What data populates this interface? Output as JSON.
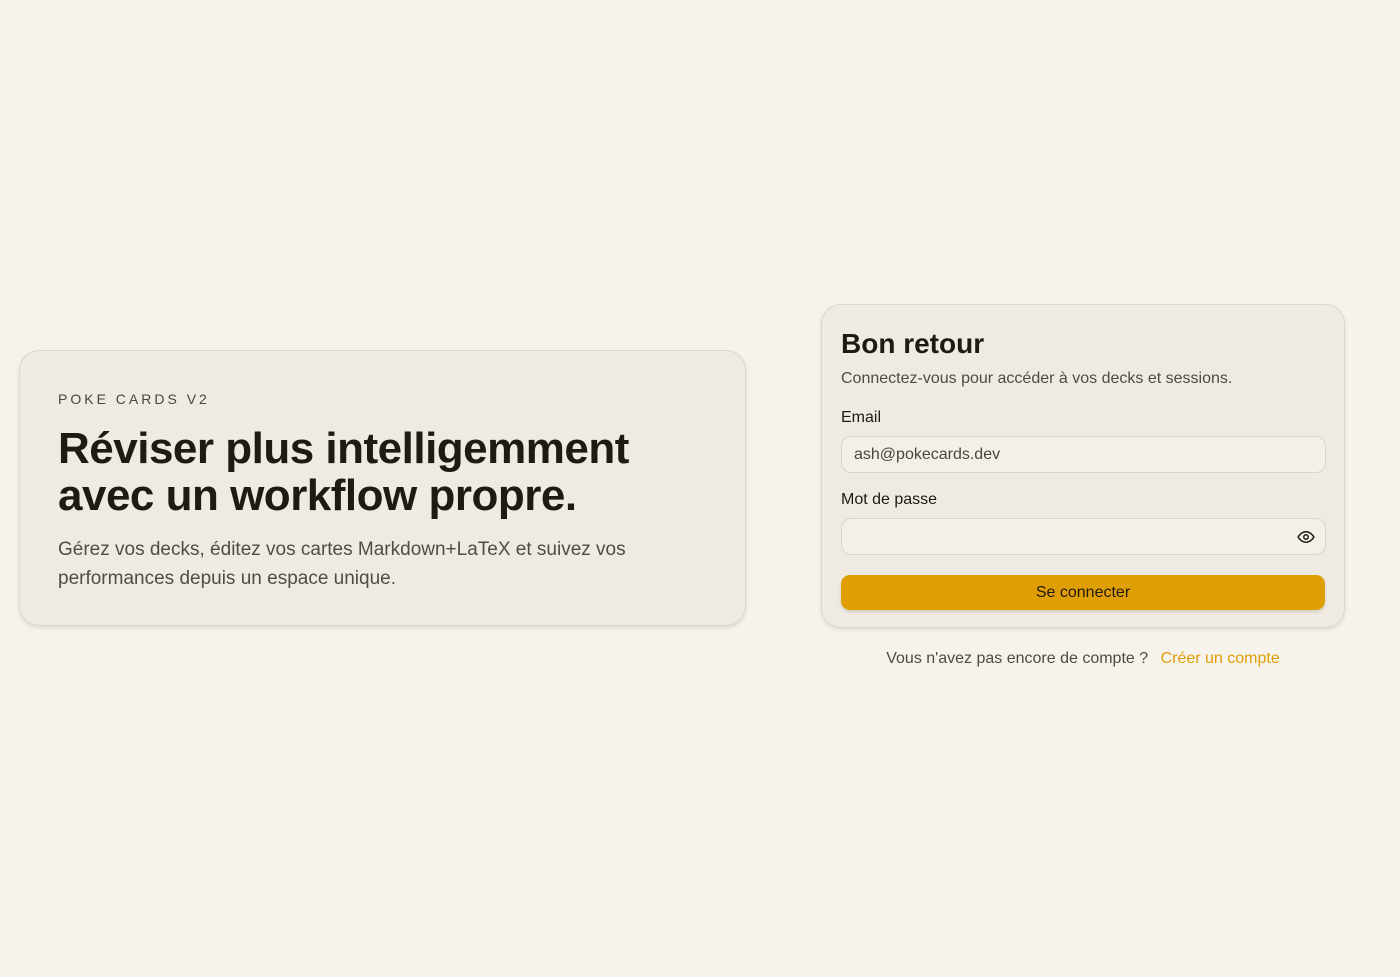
{
  "hero": {
    "eyebrow": "POKE CARDS V2",
    "title_line1": "Réviser plus intelligemment",
    "title_line2": "avec un workflow propre.",
    "description": "Gérez vos decks, éditez vos cartes Markdown+LaTeX et suivez vos performances depuis un espace unique."
  },
  "login": {
    "title": "Bon retour",
    "subtitle": "Connectez-vous pour accéder à vos decks et sessions.",
    "email_label": "Email",
    "email_value": "ash@pokecards.dev",
    "password_label": "Mot de passe",
    "password_value": "",
    "password_toggle_icon": "eye-icon",
    "submit_label": "Se connecter"
  },
  "signup": {
    "prompt": "Vous n'avez pas encore de compte ?",
    "link_label": "Créer un compte"
  },
  "colors": {
    "background": "#f6f3ec",
    "card": "#efebe3",
    "accent": "#e09e05",
    "text": "#1f1a12"
  }
}
